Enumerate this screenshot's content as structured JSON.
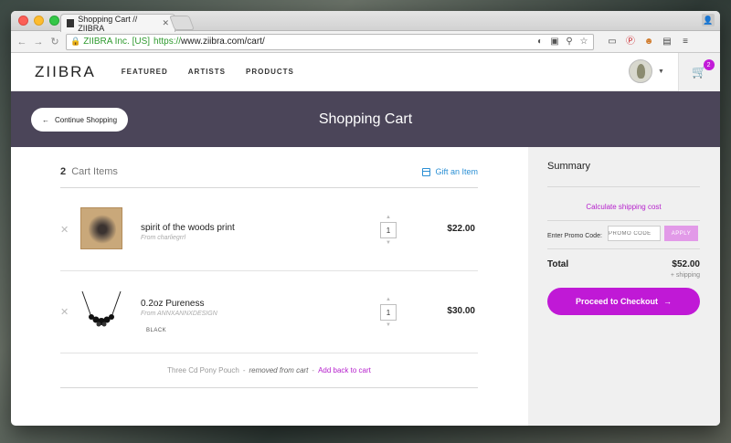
{
  "browser": {
    "tab_title": "Shopping Cart // ZIIBRA",
    "ev_label": "ZIIBRA Inc. [US]",
    "url_scheme": "https://",
    "url_rest": "www.ziibra.com/cart/"
  },
  "site": {
    "logo": "ZIIBRA",
    "nav": [
      "FEATURED",
      "ARTISTS",
      "PRODUCTS"
    ],
    "cart_badge": "2"
  },
  "hero": {
    "title": "Shopping Cart",
    "continue_label": "Continue Shopping"
  },
  "cart": {
    "count": "2",
    "count_label": "Cart Items",
    "gift_label": "Gift an Item",
    "items": [
      {
        "title": "spirit of the woods print",
        "from": "From charliegrrl",
        "variant": "",
        "qty": "1",
        "price": "$22.00"
      },
      {
        "title": "0.2oz Pureness",
        "from": "From ANNXANNXDESIGN",
        "variant": "BLACK",
        "qty": "1",
        "price": "$30.00"
      }
    ],
    "removed": {
      "name": "Three Cd Pony Pouch",
      "sep": " - ",
      "status": "removed from cart",
      "dash": " - ",
      "add_back": "Add back to cart"
    }
  },
  "summary": {
    "title": "Summary",
    "calc_shipping": "Calculate shipping cost",
    "promo_label": "Enter Promo Code:",
    "promo_placeholder": "PROMO CODE",
    "apply_label": "APPLY",
    "total_label": "Total",
    "total_value": "$52.00",
    "shipping_note": "+ shipping",
    "checkout_label": "Proceed to Checkout"
  },
  "colors": {
    "hero_bg": "#4b4559",
    "accent": "#c019d6",
    "gift_link": "#2a8fd4",
    "ev_green": "#2e9a2e"
  }
}
